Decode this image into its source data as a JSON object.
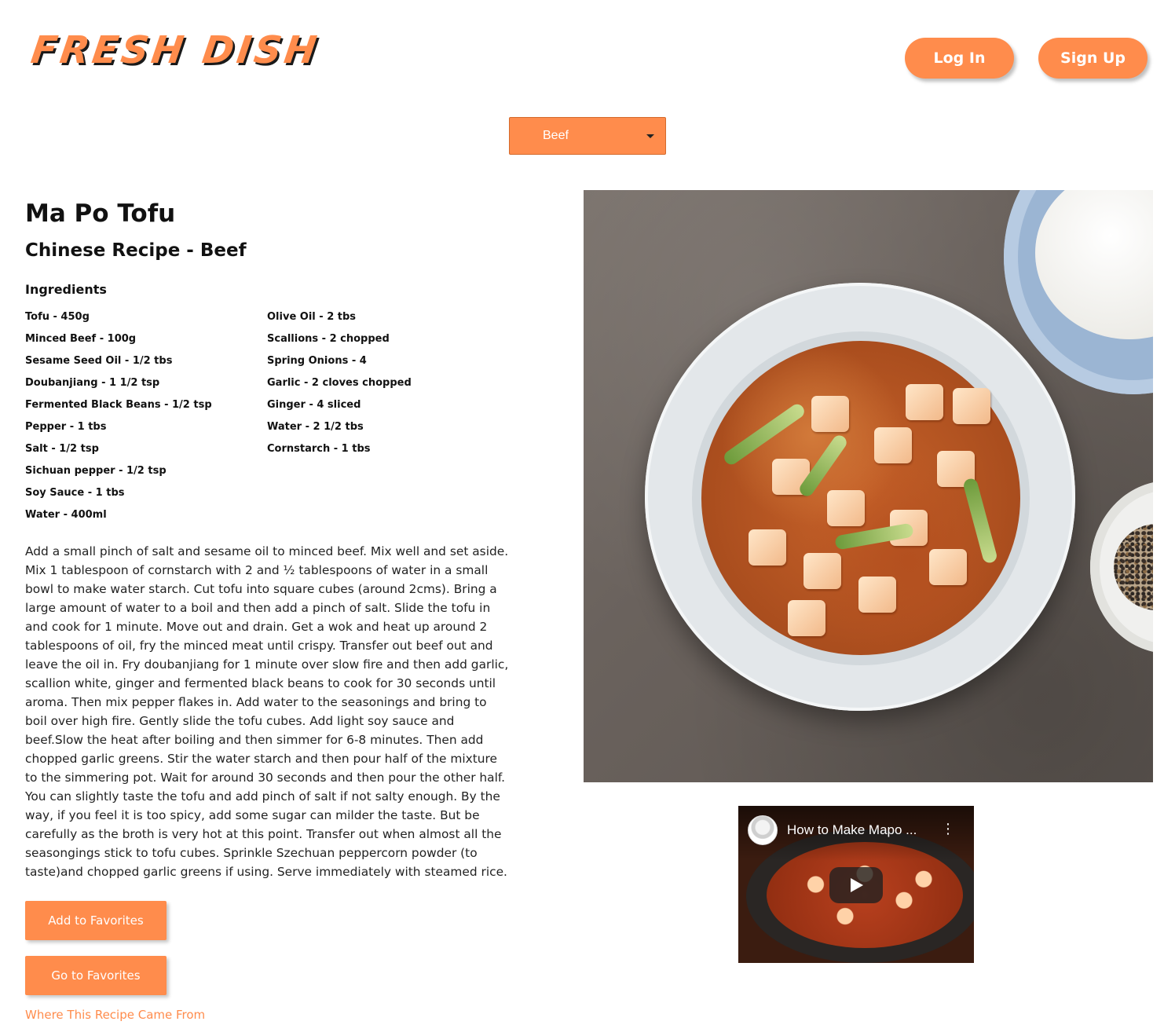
{
  "header": {
    "logo_text": "FRESH DISH",
    "login_label": "Log In",
    "signup_label": "Sign Up"
  },
  "category_select": {
    "selected": "Beef"
  },
  "recipe": {
    "title": "Ma Po Tofu",
    "subtitle": "Chinese Recipe - Beef",
    "ingredients_heading": "Ingredients",
    "ingredients_left": [
      "Tofu - 450g",
      "Minced Beef - 100g",
      "Sesame Seed Oil - 1/2 tbs",
      "Doubanjiang - 1 1/2 tsp",
      "Fermented Black Beans - 1/2 tsp",
      "Pepper - 1 tbs",
      "Salt - 1/2 tsp",
      "Sichuan pepper - 1/2 tsp",
      "Soy Sauce - 1 tbs",
      "Water - 400ml"
    ],
    "ingredients_right": [
      "Olive Oil - 2 tbs",
      "Scallions - 2 chopped",
      "Spring Onions - 4",
      "Garlic - 2 cloves chopped",
      "Ginger - 4 sliced",
      "Water - 2 1/2 tbs",
      "Cornstarch - 1 tbs"
    ],
    "instructions": "Add a small pinch of salt and sesame oil to minced beef. Mix well and set aside. Mix 1 tablespoon of cornstarch with 2 and ½ tablespoons of water in a small bowl to make water starch. Cut tofu into square cubes (around 2cms). Bring a large amount of water to a boil and then add a pinch of salt. Slide the tofu in and cook for 1 minute. Move out and drain. Get a wok and heat up around 2 tablespoons of oil, fry the minced meat until crispy. Transfer out beef out and leave the oil in. Fry doubanjiang for 1 minute over slow fire and then add garlic, scallion white, ginger and fermented black beans to cook for 30 seconds until aroma. Then mix pepper flakes in. Add water to the seasonings and bring to boil over high fire. Gently slide the tofu cubes. Add light soy sauce and beef.Slow the heat after boiling and then simmer for 6-8 minutes. Then add chopped garlic greens. Stir the water starch and then pour half of the mixture to the simmering pot. Wait for around 30 seconds and then pour the other half. You can slightly taste the tofu and add pinch of salt if not salty enough. By the way, if you feel it is too spicy, add some sugar can milder the taste. But be carefully as the broth is very hot at this point. Transfer out when almost all the seasongings stick to tofu cubes. Sprinkle Szechuan peppercorn powder (to taste)and chopped garlic greens if using. Serve immediately with steamed rice."
  },
  "actions": {
    "add_favorites_label": "Add to Favorites",
    "go_favorites_label": "Go to Favorites",
    "source_link_label": "Where This Recipe Came From"
  },
  "video": {
    "title": "How to Make Mapo ...",
    "menu_icon": "vertical-dots-icon",
    "play_icon": "play-icon"
  },
  "colors": {
    "accent": "#ff8c4c",
    "text": "#222222"
  }
}
